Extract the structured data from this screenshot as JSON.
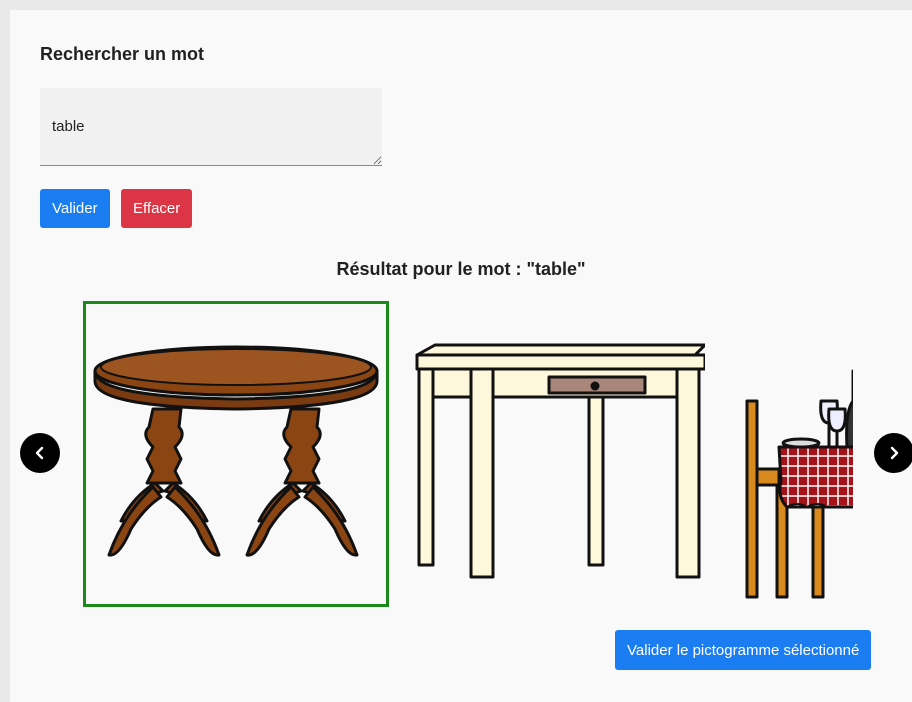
{
  "search": {
    "title": "Rechercher un mot",
    "value": "table"
  },
  "buttons": {
    "validate": "Valider",
    "clear": "Effacer",
    "validate_picto": "Valider le pictogramme sélectionné"
  },
  "results": {
    "title": "Résultat pour le mot : \"table\"",
    "items": [
      {
        "name": "round-pedestal-table",
        "selected": true
      },
      {
        "name": "desk-table-with-drawer",
        "selected": false
      },
      {
        "name": "restaurant-table-with-chair",
        "selected": false
      }
    ]
  },
  "icons": {
    "prev": "chevron-left-icon",
    "next": "chevron-right-icon"
  },
  "colors": {
    "primary": "#1a7ef2",
    "danger": "#dc3545",
    "selected_border": "#1b8a1b"
  }
}
